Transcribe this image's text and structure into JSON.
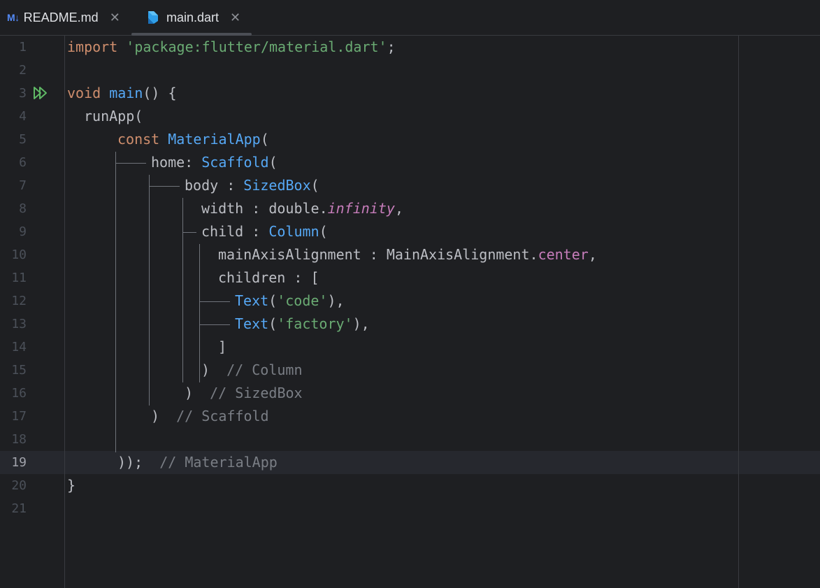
{
  "tabs": [
    {
      "icon": "markdown-icon",
      "icon_text": "M↓",
      "label": "README.md",
      "active": false
    },
    {
      "icon": "dart-icon",
      "label": "main.dart",
      "active": true
    }
  ],
  "tab_close_glyph": "✕",
  "editor": {
    "current_line": 19,
    "lines": [
      {
        "n": "1"
      },
      {
        "n": "2"
      },
      {
        "n": "3"
      },
      {
        "n": "4"
      },
      {
        "n": "5"
      },
      {
        "n": "6"
      },
      {
        "n": "7"
      },
      {
        "n": "8"
      },
      {
        "n": "9"
      },
      {
        "n": "10"
      },
      {
        "n": "11"
      },
      {
        "n": "12"
      },
      {
        "n": "13"
      },
      {
        "n": "14"
      },
      {
        "n": "15"
      },
      {
        "n": "16"
      },
      {
        "n": "17"
      },
      {
        "n": "18"
      },
      {
        "n": "19"
      },
      {
        "n": "20"
      },
      {
        "n": "21"
      }
    ],
    "tokens": {
      "l1": [
        "import",
        " ",
        "'package:flutter/material.dart'",
        ";"
      ],
      "l3": [
        "void",
        " ",
        "main",
        "() {"
      ],
      "l4": [
        "runApp("
      ],
      "l5": [
        "const",
        " ",
        "MaterialApp",
        "("
      ],
      "l6": [
        "home: ",
        "Scaffold",
        "("
      ],
      "l7": [
        "body : ",
        "SizedBox",
        "("
      ],
      "l8": [
        "width : double.",
        "infinity",
        ","
      ],
      "l9": [
        "child : ",
        "Column",
        "("
      ],
      "l10": [
        "mainAxisAlignment : MainAxisAlignment.",
        "center",
        ","
      ],
      "l11": [
        "children : ["
      ],
      "l12": [
        "Text",
        "(",
        "'code'",
        "),"
      ],
      "l13": [
        "Text",
        "(",
        "'factory'",
        "),"
      ],
      "l14": [
        "]"
      ],
      "l15": [
        ")",
        "// Column"
      ],
      "l16": [
        ")",
        "// SizedBox"
      ],
      "l17": [
        ")",
        "// Scaffold"
      ],
      "l19": [
        "));",
        "// MaterialApp"
      ],
      "l20": [
        "}"
      ]
    }
  },
  "colors": {
    "background": "#1e1f22",
    "keyword": "#cf8e6d",
    "string": "#6aab73",
    "function": "#56a8f5",
    "field": "#c77dbb",
    "comment": "#7a7e85",
    "run_icon": "#5fb865"
  }
}
